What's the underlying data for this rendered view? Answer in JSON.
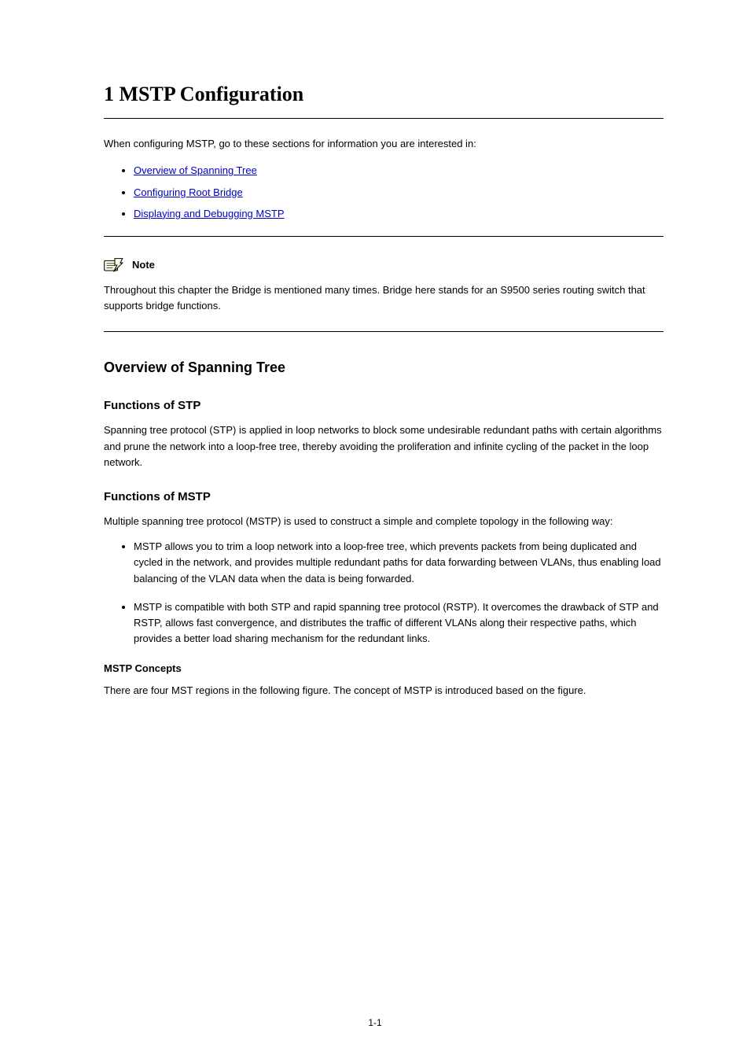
{
  "chapter": {
    "title": "1 MSTP Configuration"
  },
  "lead": "When configuring MSTP, go to these sections for information you are interested in:",
  "toc": [
    {
      "label": "Overview of Spanning Tree",
      "href": "#overview"
    },
    {
      "label": "Configuring Root Bridge",
      "href": "#root-bridge"
    },
    {
      "label": "Displaying and Debugging MSTP",
      "href": "#display-debug"
    }
  ],
  "note": {
    "label": "Note",
    "text": "Throughout this chapter the Bridge is mentioned many times. Bridge here stands for an S9500 series routing switch that supports bridge functions."
  },
  "overview": {
    "heading": "Overview of Spanning Tree",
    "stp_sub": "Functions of STP",
    "stp_p1": "Spanning tree protocol (STP) is applied in loop networks to block some undesirable redundant paths with certain algorithms and prune the network into a loop-free tree, thereby avoiding the proliferation and infinite cycling of the packet in the loop network.",
    "mstp_sub": "Functions of MSTP",
    "mstp_p1": "Multiple spanning tree protocol (MSTP) is used to construct a simple and complete topology in the following way:",
    "mstp_b1": "MSTP allows you to trim a loop network into a loop-free tree, which prevents packets from being duplicated and cycled in the network, and provides multiple redundant paths for data forwarding between VLANs, thus enabling load balancing of the VLAN data when the data is being forwarded.",
    "mstp_b2": "MSTP is compatible with both STP and rapid spanning tree protocol (RSTP). It overcomes the drawback of STP and RSTP, allows fast convergence, and distributes the traffic of different VLANs along their respective paths, which provides a better load sharing mechanism for the redundant links.",
    "concepts_sub": "MSTP Concepts",
    "concepts_p1": "There are four MST regions in the following figure. The concept of MSTP is introduced based on the figure."
  },
  "pagenum": "1-1"
}
